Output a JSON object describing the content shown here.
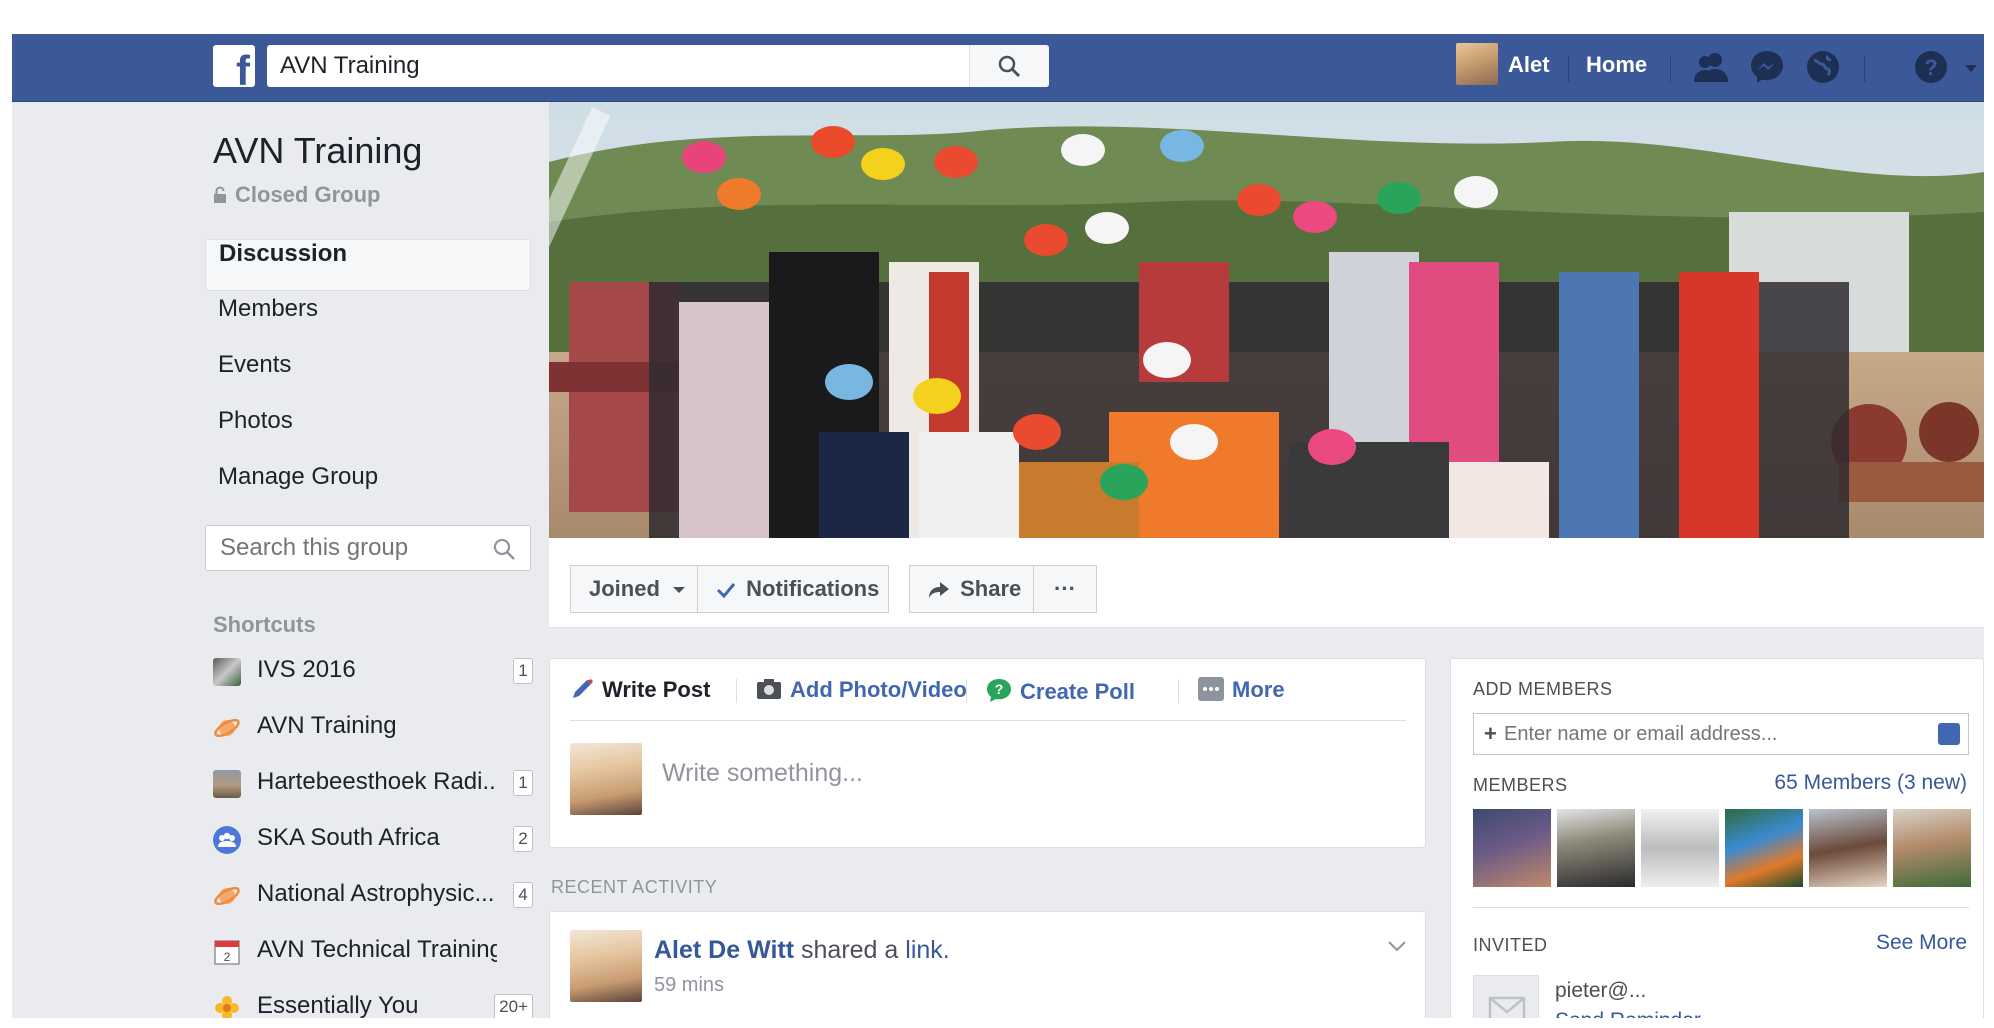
{
  "topbar": {
    "logo": "f",
    "search_value": "AVN Training",
    "user_name": "Alet",
    "home_label": "Home",
    "colors": {
      "brand": "#3b5998",
      "link": "#365899"
    }
  },
  "group": {
    "title": "AVN Training",
    "privacy": "Closed Group"
  },
  "nav": {
    "items": [
      {
        "label": "Discussion"
      },
      {
        "label": "Members"
      },
      {
        "label": "Events"
      },
      {
        "label": "Photos"
      },
      {
        "label": "Manage Group"
      }
    ],
    "search_placeholder": "Search this group"
  },
  "shortcuts": {
    "title": "Shortcuts",
    "items": [
      {
        "label": "IVS 2016",
        "badge": "1",
        "icon": "ivs-photo-icon"
      },
      {
        "label": "AVN Training",
        "badge": "",
        "icon": "planet-icon"
      },
      {
        "label": "Hartebeesthoek Radi...",
        "badge": "1",
        "icon": "group-photo-icon"
      },
      {
        "label": "SKA South Africa",
        "badge": "2",
        "icon": "group-icon"
      },
      {
        "label": "National Astrophysic...",
        "badge": "4",
        "icon": "planet-icon"
      },
      {
        "label": "AVN Technical Training ...",
        "badge": "",
        "icon": "calendar-icon"
      },
      {
        "label": "Essentially You",
        "badge": "20+",
        "icon": "flower-icon"
      }
    ]
  },
  "actions": {
    "joined": "Joined",
    "notifications": "Notifications",
    "share": "Share",
    "more": "···"
  },
  "composer": {
    "tabs": [
      {
        "label": "Write Post"
      },
      {
        "label": "Add Photo/Video"
      },
      {
        "label": "Create Poll"
      },
      {
        "label": "More"
      }
    ],
    "placeholder": "Write something..."
  },
  "recent": {
    "title": "RECENT ACTIVITY",
    "story": {
      "author": "Alet De Witt",
      "verb": "shared a",
      "object": "link.",
      "time": "59 mins"
    }
  },
  "sidebar": {
    "add_members_title": "ADD MEMBERS",
    "add_placeholder": "Enter name or email address...",
    "members_title": "MEMBERS",
    "members_link": "65 Members (3 new)",
    "invited_title": "INVITED",
    "see_more": "See More",
    "invite_email": "pieter@...",
    "send_reminder": "Send Reminder"
  }
}
